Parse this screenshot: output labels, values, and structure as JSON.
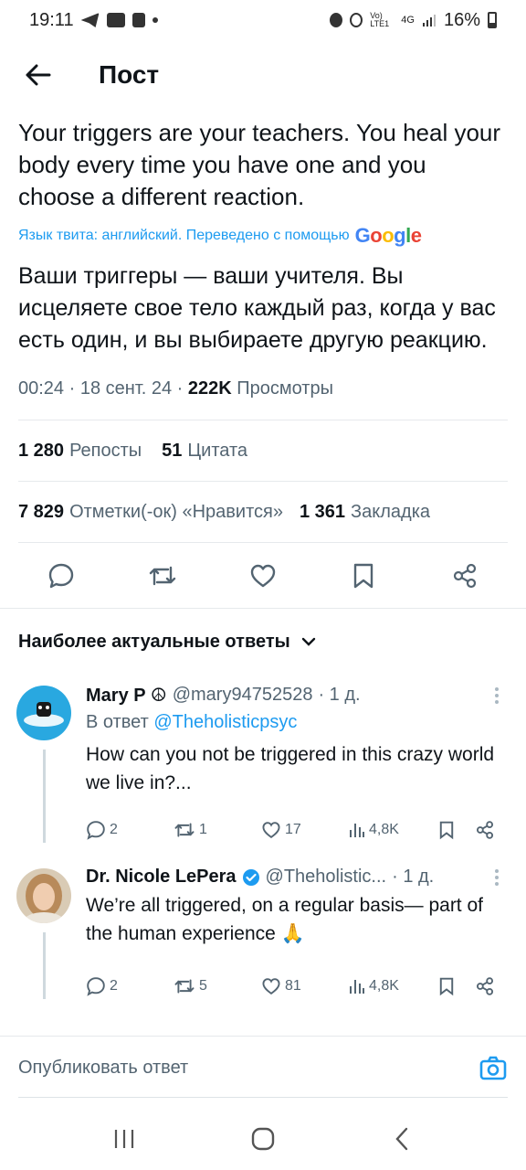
{
  "status": {
    "time": "19:11",
    "battery": "16%",
    "network": "4G",
    "volte": "Vo) LTE1"
  },
  "header": {
    "title": "Пост"
  },
  "tweet": {
    "text_en": "Your triggers are your teachers. You heal your body every time you have one and you choose a different reaction.",
    "translation_note": "Язык твита: английский. Переведено с помощью",
    "translator": "Google",
    "text_ru": "Ваши триггеры — ваши учителя. Вы исцеляете свое тело каждый раз, когда у вас есть один, и вы выбираете другую реакцию.",
    "time": "00:24 · 18 сент. 24 · ",
    "views_count": "222K",
    "views_label": "Просмотры",
    "reposts_count": "1 280",
    "reposts_label": "Репосты",
    "quotes_count": "51",
    "quotes_label": "Цитата",
    "likes_count": "7 829",
    "likes_label": "Отметки(-ок) «Нравится»",
    "bookmarks_count": "1 361",
    "bookmarks_label": "Закладка"
  },
  "sort": {
    "label": "Наиболее актуальные ответы"
  },
  "replies": [
    {
      "name": "Mary P ☮",
      "handle": "@mary94752528",
      "time": "· 1 д.",
      "replying_prefix": "В ответ",
      "replying_to": "@Theholisticpsyc",
      "text": "How can you not be triggered in this crazy world we live in?...",
      "replies": "2",
      "reposts": "1",
      "likes": "17",
      "views": "4,8K"
    },
    {
      "name": "Dr. Nicole LePera",
      "handle": "@Theholistic...",
      "time": "· 1 д.",
      "text": "We’re all triggered, on a regular basis— part of the human experience 🙏",
      "replies": "2",
      "reposts": "5",
      "likes": "81",
      "views": "4,8K"
    }
  ],
  "compose": {
    "placeholder": "Опубликовать ответ"
  },
  "colors": {
    "accent": "#1d9bf0",
    "text": "#0f1419",
    "muted": "#536471",
    "verified": "#1d9bf0"
  }
}
